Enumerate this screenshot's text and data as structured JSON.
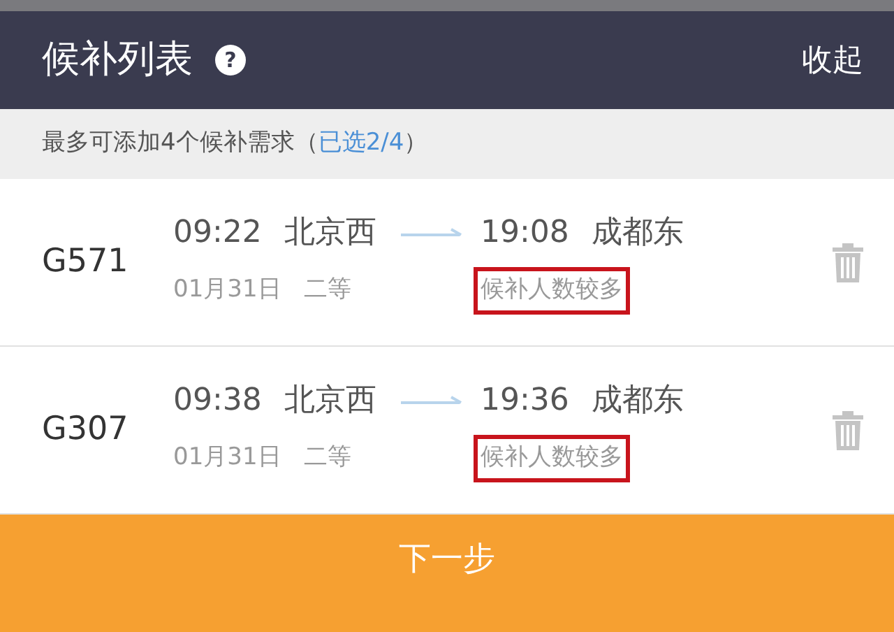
{
  "header": {
    "title": "候补列表",
    "help_icon": "?",
    "collapse": "收起"
  },
  "notice": {
    "text": "最多可添加4个候补需求（",
    "selected": "已选2/4",
    "close": "）"
  },
  "trains": [
    {
      "number": "G571",
      "depart_time": "09:22",
      "from": "北京西",
      "arrive_time": "19:08",
      "to": "成都东",
      "date": "01月31日",
      "seat": "二等",
      "status": "候补人数较多",
      "highlighted": true
    },
    {
      "number": "G307",
      "depart_time": "09:38",
      "from": "北京西",
      "arrive_time": "19:36",
      "to": "成都东",
      "date": "01月31日",
      "seat": "二等",
      "status": "候补人数较多",
      "highlighted": true
    }
  ],
  "next_button": "下一步"
}
